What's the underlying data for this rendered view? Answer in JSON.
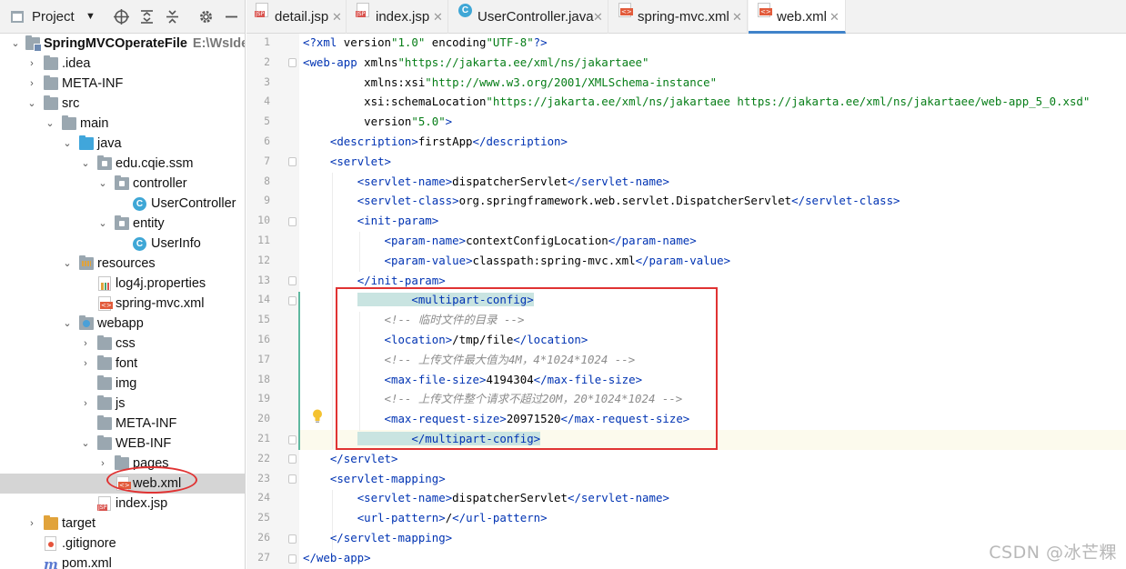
{
  "project_panel": {
    "title": "Project",
    "tree": [
      {
        "label": "SpringMVCOperateFile",
        "sub": "E:\\WsIdea",
        "bold": true
      },
      {
        "label": ".idea"
      },
      {
        "label": "META-INF"
      },
      {
        "label": "src"
      },
      {
        "label": "main"
      },
      {
        "label": "java"
      },
      {
        "label": "edu.cqie.ssm"
      },
      {
        "label": "controller"
      },
      {
        "label": "UserController"
      },
      {
        "label": "entity"
      },
      {
        "label": "UserInfo"
      },
      {
        "label": "resources"
      },
      {
        "label": "log4j.properties"
      },
      {
        "label": "spring-mvc.xml"
      },
      {
        "label": "webapp"
      },
      {
        "label": "css"
      },
      {
        "label": "font"
      },
      {
        "label": "img"
      },
      {
        "label": "js"
      },
      {
        "label": "META-INF"
      },
      {
        "label": "WEB-INF"
      },
      {
        "label": "pages"
      },
      {
        "label": "web.xml"
      },
      {
        "label": "index.jsp"
      },
      {
        "label": "target"
      },
      {
        "label": ".gitignore"
      },
      {
        "label": "pom.xml"
      }
    ]
  },
  "tabs": [
    {
      "label": "detail.jsp",
      "icon": "jsp-file-icon",
      "active": false
    },
    {
      "label": "index.jsp",
      "icon": "jsp-file-icon",
      "active": false
    },
    {
      "label": "UserController.java",
      "icon": "java-class-icon",
      "active": false
    },
    {
      "label": "spring-mvc.xml",
      "icon": "xml-file-icon",
      "active": false
    },
    {
      "label": "web.xml",
      "icon": "xml-file-icon",
      "active": true
    }
  ],
  "editor": {
    "line_numbers": [
      "1",
      "2",
      "3",
      "4",
      "5",
      "6",
      "7",
      "8",
      "9",
      "10",
      "11",
      "12",
      "13",
      "14",
      "15",
      "16",
      "17",
      "18",
      "19",
      "20",
      "21",
      "22",
      "23",
      "24",
      "25",
      "26",
      "27"
    ],
    "lines": [
      "<?xml version=\"1.0\" encoding=\"UTF-8\"?>",
      "<web-app xmlns=\"https://jakarta.ee/xml/ns/jakartaee\"",
      "         xmlns:xsi=\"http://www.w3.org/2001/XMLSchema-instance\"",
      "         xsi:schemaLocation=\"https://jakarta.ee/xml/ns/jakartaee https://jakarta.ee/xml/ns/jakartaee/web-app_5_0.xsd\"",
      "         version=\"5.0\">",
      "    <description>firstApp</description>",
      "    <servlet>",
      "        <servlet-name>dispatcherServlet</servlet-name>",
      "        <servlet-class>org.springframework.web.servlet.DispatcherServlet</servlet-class>",
      "        <init-param>",
      "            <param-name>contextConfigLocation</param-name>",
      "            <param-value>classpath:spring-mvc.xml</param-value>",
      "        </init-param>",
      "        <multipart-config>",
      "            <!-- 临时文件的目录 -->",
      "            <location>/tmp/file</location>",
      "            <!-- 上传文件最大值为4M，4*1024*1024 -->",
      "            <max-file-size>4194304</max-file-size>",
      "            <!-- 上传文件整个请求不超过20M，20*1024*1024 -->",
      "            <max-request-size>20971520</max-request-size>",
      "        </multipart-config>",
      "    </servlet>",
      "    <servlet-mapping>",
      "        <servlet-name>dispatcherServlet</servlet-name>",
      "        <url-pattern>/</url-pattern>",
      "    </servlet-mapping>",
      "</web-app>"
    ]
  },
  "watermark": "CSDN @冰芒粿",
  "colors": {
    "tag": "#0033b3",
    "attr": "#174ad4",
    "namespace": "#871094",
    "string": "#067d17",
    "comment": "#8c8c8c",
    "annotation_red": "#e03333",
    "active_tab_underline": "#4083c9"
  }
}
